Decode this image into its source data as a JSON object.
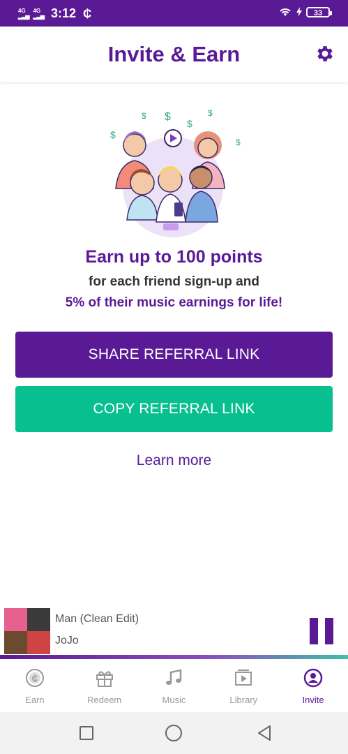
{
  "status_bar": {
    "network_1": "4G",
    "network_2": "4G",
    "time": "3:12",
    "battery": "33"
  },
  "header": {
    "title": "Invite & Earn"
  },
  "promo": {
    "headline": "Earn up to 100 points",
    "line1": "for each friend sign-up and",
    "line2": "5% of their music earnings for life!"
  },
  "buttons": {
    "share": "SHARE REFERRAL LINK",
    "copy": "COPY REFERRAL LINK",
    "learn_more": "Learn more"
  },
  "player": {
    "track": "Man (Clean Edit)",
    "artist": "JoJo"
  },
  "nav": {
    "items": [
      {
        "label": "Earn",
        "icon": "earn-coin-icon"
      },
      {
        "label": "Redeem",
        "icon": "gift-icon"
      },
      {
        "label": "Music",
        "icon": "music-note-icon"
      },
      {
        "label": "Library",
        "icon": "library-play-icon"
      },
      {
        "label": "Invite",
        "icon": "invite-person-icon"
      }
    ],
    "active": "Invite"
  },
  "colors": {
    "brand_purple": "#5a1a96",
    "accent_green": "#08c08f",
    "status_bar": "#5a1a96"
  }
}
